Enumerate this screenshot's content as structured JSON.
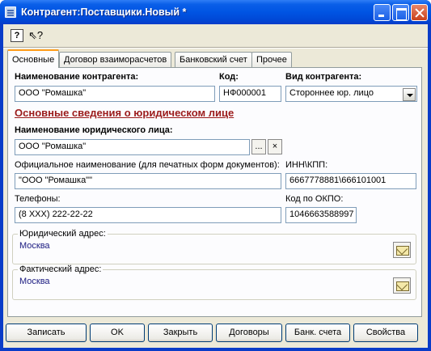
{
  "window": {
    "title": "Контрагент:Поставщики.Новый *"
  },
  "toolbar": {
    "help": "?",
    "pointer": "⇖?"
  },
  "tabs": [
    {
      "label": "Основные"
    },
    {
      "label": "Договор взаиморасчетов"
    },
    {
      "label": "Банковский счет"
    },
    {
      "label": "Прочее"
    }
  ],
  "form": {
    "name_label": "Наименование контрагента:",
    "name_value": "ООО \"Ромашка\"",
    "code_label": "Код:",
    "code_value": "НФ000001",
    "type_label": "Вид контрагента:",
    "type_value": "Стороннее юр. лицо",
    "section_title": "Основные сведения о юридическом лице",
    "legal_name_label": "Наименование юридического лица:",
    "legal_name_value": "ООО \"Ромашка\"",
    "legal_name_pick": "...",
    "legal_name_clear": "×",
    "official_label": "Официальное наименование (для печатных форм документов):",
    "official_value": "\"ООО \"Ромашка\"\"",
    "inn_label": "ИНН\\КПП:",
    "inn_value": "6667778881\\666101001",
    "phones_label": "Телефоны:",
    "phones_value": "(8 XXX) 222-22-22",
    "okpo_label": "Код по ОКПО:",
    "okpo_value": "1046663588997",
    "legal_address_label": "Юридический адрес:",
    "legal_address_value": "Москва",
    "actual_address_label": "Фактический адрес:",
    "actual_address_value": "Москва"
  },
  "buttons": {
    "save": "Записать",
    "ok": "OK",
    "close": "Закрыть",
    "contracts": "Договоры",
    "bank": "Банк. счета",
    "props": "Свойства"
  }
}
